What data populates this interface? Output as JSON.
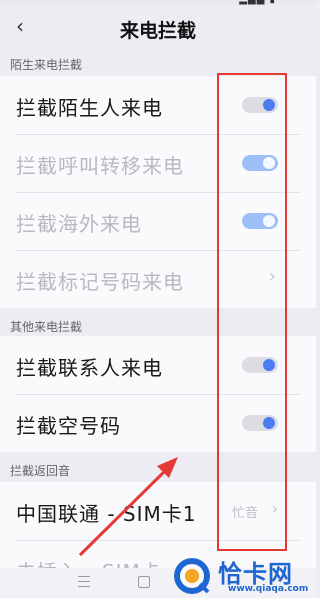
{
  "colors": {
    "accent": "#4c7cf3",
    "toggle_on_track": "#9cc0f6",
    "annotation_red": "#e53935",
    "watermark_blue": "#1e66d0"
  },
  "header": {
    "back_icon": "chevron-left-icon",
    "title": "来电拦截"
  },
  "section_stranger": {
    "label": "陌生来电拦截",
    "rows": [
      {
        "label": "拦截陌生人来电",
        "control": "toggle",
        "checked": true,
        "disabled": false
      },
      {
        "label": "拦截呼叫转移来电",
        "control": "toggle",
        "checked": true,
        "disabled": true
      },
      {
        "label": "拦截海外来电",
        "control": "toggle",
        "checked": true,
        "disabled": true
      },
      {
        "label": "拦截标记号码来电",
        "control": "chevron",
        "disabled": true
      }
    ]
  },
  "section_other": {
    "label": "其他来电拦截",
    "rows": [
      {
        "label": "拦截联系人来电",
        "control": "toggle",
        "checked": true,
        "disabled": false
      },
      {
        "label": "拦截空号码",
        "control": "toggle",
        "checked": true,
        "disabled": false
      }
    ]
  },
  "section_return": {
    "label": "拦截返回音",
    "rows": [
      {
        "label": "中国联通 - SIM卡1",
        "value": "忙音",
        "control": "chevron"
      },
      {
        "label": "未插入 - SIM卡",
        "control": "chevron",
        "disabled": true
      }
    ]
  },
  "bottom_nav": {
    "menu_icon": "menu-icon",
    "home_icon": "home-icon"
  },
  "watermark": {
    "name": "恰卡网",
    "url": "www.qiaqa.com"
  }
}
